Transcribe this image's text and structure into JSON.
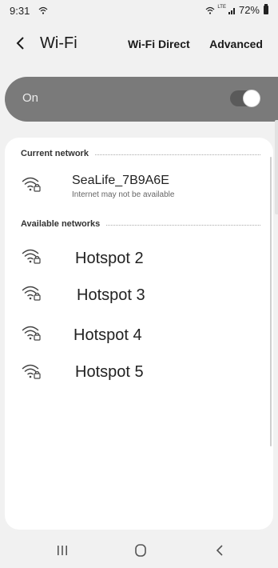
{
  "status_bar": {
    "time": "9:31",
    "lte": "LTE",
    "battery": "72%"
  },
  "header": {
    "back_icon": "chevron-left-icon",
    "title": "Wi-Fi",
    "wifi_direct": "Wi-Fi Direct",
    "advanced": "Advanced"
  },
  "toggle": {
    "label": "On",
    "state": true
  },
  "current_network": {
    "heading": "Current network",
    "name": "SeaLife_7B9A6E",
    "status": "Internet may not be available",
    "icon": "wifi-locked-icon"
  },
  "available_networks": {
    "heading": "Available networks",
    "items": [
      {
        "name": "Hotspot 2",
        "icon": "wifi-locked-icon"
      },
      {
        "name": "Hotspot 3",
        "icon": "wifi-locked-icon"
      },
      {
        "name": "Hotspot 4",
        "icon": "wifi-locked-icon"
      },
      {
        "name": "Hotspot 5",
        "icon": "wifi-locked-icon"
      }
    ]
  },
  "nav_bar": {
    "recents": "recents-icon",
    "home": "home-icon",
    "back": "back-icon"
  },
  "colors": {
    "background": "#f1f1f1",
    "toggle_bar": "#7a7a7a",
    "card": "#ffffff"
  }
}
